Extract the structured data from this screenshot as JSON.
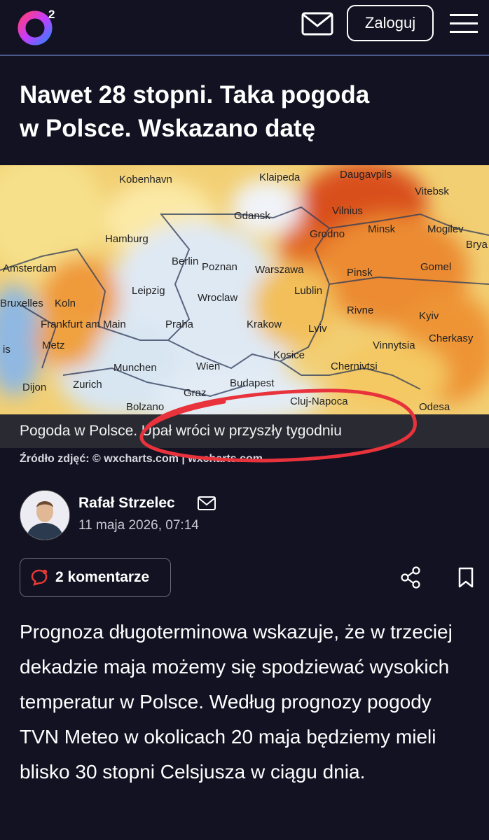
{
  "header": {
    "logo_sup": "2",
    "login_label": "Zaloguj"
  },
  "article": {
    "title_line1": "Nawet 28 stopni. Taka pogoda",
    "title_line2": "w Polsce. Wskazano datę",
    "image": {
      "caption": "Pogoda w Polsce. Upał wróci w przyszły tygodniu",
      "source": "Źródło zdjęć: © wxcharts.com | wxcharts.com",
      "map_labels": [
        "Kobenhavn",
        "Klaipeda",
        "Daugavpils",
        "Vitebsk",
        "Vilnius",
        "Gdansk",
        "Hamburg",
        "Grodno",
        "Minsk",
        "Mogilev",
        "Brya",
        "Amsterdam",
        "Berlin",
        "Poznan",
        "Warszawa",
        "Gomel",
        "Pinsk",
        "Bruxelles",
        "Koln",
        "Leipzig",
        "Wroclaw",
        "Lublin",
        "Rivne",
        "Kyiv",
        "Frankfurt am Main",
        "Praha",
        "Krakow",
        "Lviv",
        "Vinnytsia",
        "Cherkasy",
        "is",
        "Metz",
        "Kosice",
        "Chernivtsi",
        "Munchen",
        "Wien",
        "Dijon",
        "Zurich",
        "Graz",
        "Budapest",
        "Cluj-Napoca",
        "Odesa",
        "Bolzano"
      ]
    },
    "author": {
      "name": "Rafał Strzelec",
      "date": "11 maja 2026, 07:14"
    },
    "comments_label": "2 komentarze",
    "body": "Prognoza długoterminowa wskazuje, że w trzeciej dekadzie maja możemy się spodziewać wysokich temperatur w Polsce. Według prognozy pogody TVN Meteo w okolicach 20 maja będziemy mieli blisko 30 stopni Celsjusza w ciągu dnia."
  },
  "colors": {
    "background": "#121222",
    "header_border": "#4a5a8a",
    "accent_red": "#e53935",
    "annotation_red": "#e8323c"
  },
  "icons": [
    "o2-logo",
    "mail-icon",
    "hamburger-menu-icon",
    "comment-icon",
    "share-icon",
    "bookmark-icon"
  ]
}
